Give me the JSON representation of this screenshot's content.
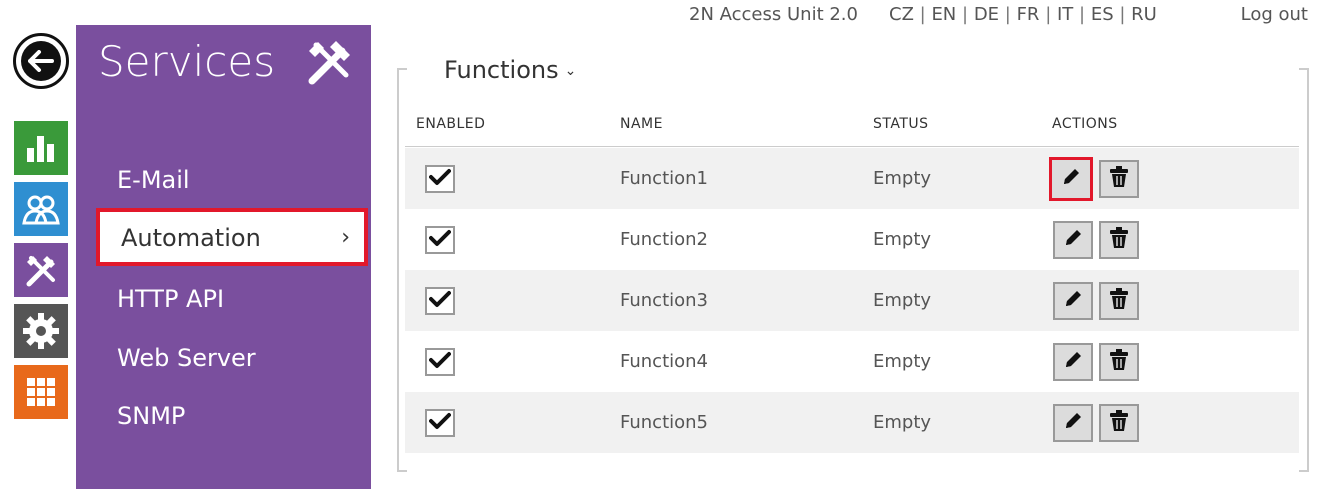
{
  "header": {
    "device_name": "2N Access Unit 2.0",
    "languages": [
      "CZ",
      "EN",
      "DE",
      "FR",
      "IT",
      "ES",
      "RU"
    ],
    "logout_label": "Log out"
  },
  "rail": {
    "icons": [
      "back-arrow-icon",
      "chart-icon",
      "users-icon",
      "tools-icon",
      "gear-icon",
      "grid-icon"
    ],
    "colors": {
      "chart": "#3a9a3a",
      "users": "#2f8fd1",
      "tools": "#7a4f9e",
      "gear": "#555555",
      "grid": "#e8691b"
    }
  },
  "services": {
    "title": "Services",
    "background": "#7a4f9e",
    "items": [
      {
        "label": "E-Mail",
        "active": false
      },
      {
        "label": "Automation",
        "active": true
      },
      {
        "label": "HTTP API",
        "active": false
      },
      {
        "label": "Web Server",
        "active": false
      },
      {
        "label": "SNMP",
        "active": false
      }
    ]
  },
  "main": {
    "section_title": "Functions",
    "columns": [
      "ENABLED",
      "NAME",
      "STATUS",
      "ACTIONS"
    ],
    "rows": [
      {
        "enabled": true,
        "name": "Function1",
        "status": "Empty"
      },
      {
        "enabled": true,
        "name": "Function2",
        "status": "Empty"
      },
      {
        "enabled": true,
        "name": "Function3",
        "status": "Empty"
      },
      {
        "enabled": true,
        "name": "Function4",
        "status": "Empty"
      },
      {
        "enabled": true,
        "name": "Function5",
        "status": "Empty"
      }
    ],
    "highlight_color": "#e2182b"
  }
}
